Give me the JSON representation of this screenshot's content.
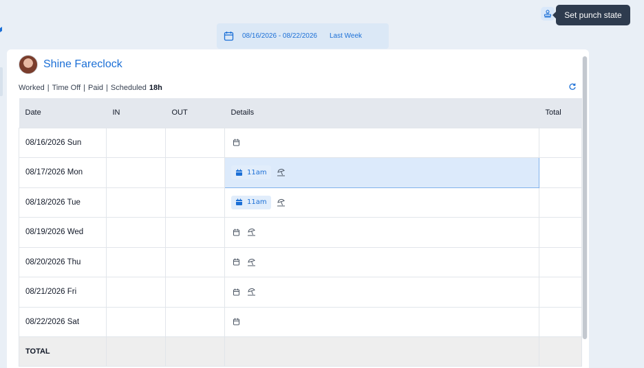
{
  "toolbar": {
    "punch_state_icon": "stamp-icon",
    "tooltip": "Set punch state"
  },
  "week": {
    "icon": "calendar-icon",
    "range": "08/16/2026 - 08/22/2026",
    "period": "Last Week"
  },
  "employee": {
    "name": "Shine Fareclock"
  },
  "summary": {
    "worked": "Worked",
    "sep1": "|",
    "time_off": "Time Off",
    "sep2": "|",
    "paid": "Paid",
    "sep3": "|",
    "scheduled_label": "Scheduled",
    "scheduled_value": "18h"
  },
  "table": {
    "headers": {
      "date": "Date",
      "in": "IN",
      "out": "OUT",
      "details": "Details",
      "total": "Total"
    },
    "rows": [
      {
        "date": "08/16/2026 Sun",
        "in": "",
        "out": "",
        "schedule": "",
        "time_off": false,
        "total": ""
      },
      {
        "date": "08/17/2026 Mon",
        "in": "",
        "out": "",
        "schedule": "11am",
        "time_off": true,
        "total": ""
      },
      {
        "date": "08/18/2026 Tue",
        "in": "",
        "out": "",
        "schedule": "11am",
        "time_off": true,
        "total": ""
      },
      {
        "date": "08/19/2026 Wed",
        "in": "",
        "out": "",
        "schedule": "",
        "time_off": true,
        "total": ""
      },
      {
        "date": "08/20/2026 Thu",
        "in": "",
        "out": "",
        "schedule": "",
        "time_off": true,
        "total": ""
      },
      {
        "date": "08/21/2026 Fri",
        "in": "",
        "out": "",
        "schedule": "",
        "time_off": true,
        "total": ""
      },
      {
        "date": "08/22/2026 Sat",
        "in": "",
        "out": "",
        "schedule": "",
        "time_off": false,
        "total": ""
      }
    ],
    "selected_row": 1,
    "footer": {
      "label": "TOTAL",
      "total": ""
    }
  },
  "colors": {
    "accent": "#1b6fd6",
    "tooltip_bg": "#2e3b4e",
    "selected_bg": "#dceafb"
  }
}
